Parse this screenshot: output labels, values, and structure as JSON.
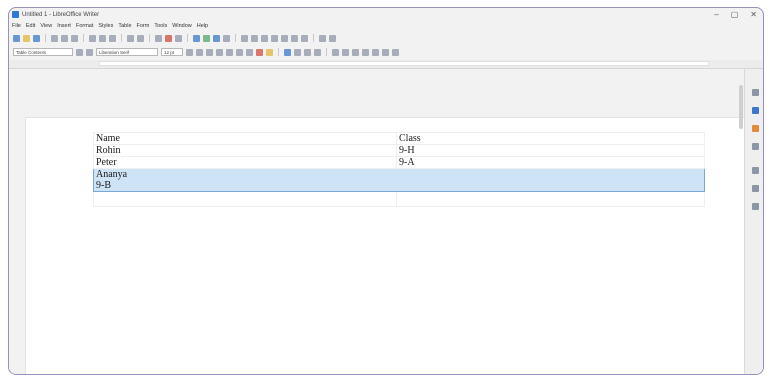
{
  "window": {
    "title": "Untitled 1 - LibreOffice Writer",
    "controls": [
      "–",
      "▢",
      "✕"
    ]
  },
  "menu": [
    "File",
    "Edit",
    "View",
    "Insert",
    "Format",
    "Styles",
    "Table",
    "Form",
    "Tools",
    "Window",
    "Help"
  ],
  "toolbar2": {
    "style": "Table Contents",
    "font": "Liberation Serif",
    "size": "12 pt"
  },
  "table": {
    "rows": [
      [
        "Name",
        "Class"
      ],
      [
        "Rohin",
        "9-H"
      ],
      [
        "Peter",
        "9-A"
      ]
    ],
    "selected_row": [
      "Ananya",
      "9-B"
    ]
  }
}
